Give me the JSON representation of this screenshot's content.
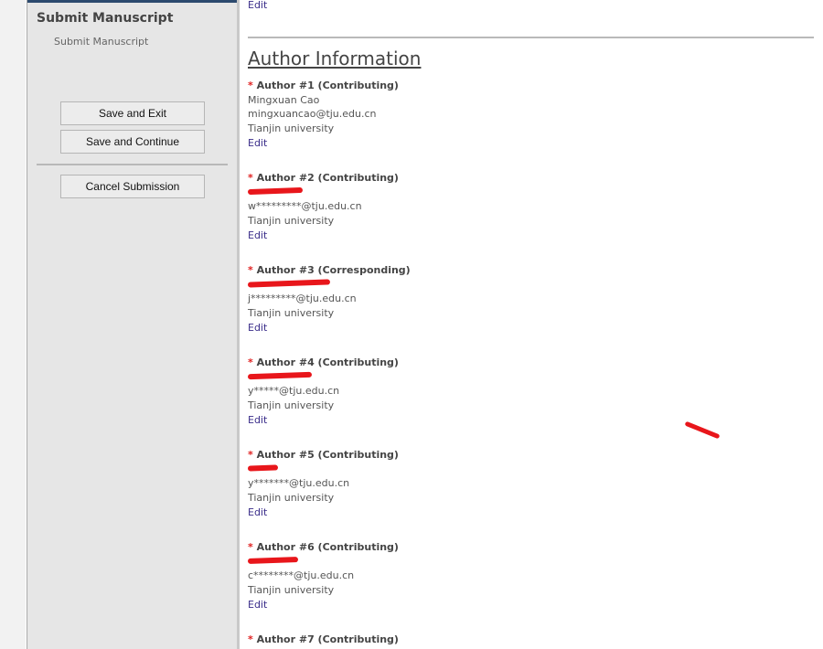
{
  "sidebar": {
    "title": "Submit Manuscript",
    "subitem": "Submit Manuscript",
    "save_exit": "Save and Exit",
    "save_continue": "Save and Continue",
    "cancel": "Cancel Submission"
  },
  "main": {
    "top_edit": "Edit",
    "section_title": "Author Information",
    "authors": [
      {
        "header": "Author #1 (Contributing)",
        "name": "Mingxuan Cao",
        "email": "mingxuancao@tju.edu.cn",
        "affiliation": "Tianjin university",
        "edit": "Edit"
      },
      {
        "header": "Author #2 (Contributing)",
        "email": "w*********@tju.edu.cn",
        "affiliation": "Tianjin university",
        "edit": "Edit"
      },
      {
        "header": "Author #3 (Corresponding)",
        "email": "j*********@tju.edu.cn",
        "affiliation": "Tianjin university",
        "edit": "Edit"
      },
      {
        "header": "Author #4 (Contributing)",
        "email": "y*****@tju.edu.cn",
        "affiliation": "Tianjin university",
        "edit": "Edit"
      },
      {
        "header": "Author #5 (Contributing)",
        "email": "y*******@tju.edu.cn",
        "affiliation": "Tianjin university",
        "edit": "Edit"
      },
      {
        "header": "Author #6 (Contributing)",
        "email": "c********@tju.edu.cn",
        "affiliation": "Tianjin university",
        "edit": "Edit"
      },
      {
        "header": "Author #7 (Contributing)"
      }
    ],
    "required_marker": "*"
  }
}
